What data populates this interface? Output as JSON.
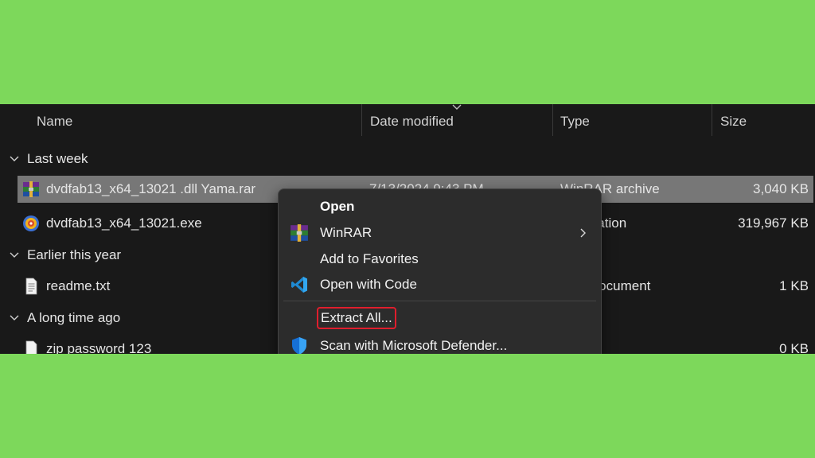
{
  "columns": {
    "name": "Name",
    "date_modified": "Date modified",
    "type": "Type",
    "size": "Size"
  },
  "groups": [
    {
      "label": "Last week"
    },
    {
      "label": "Earlier this year"
    },
    {
      "label": "A long time ago"
    }
  ],
  "files": [
    {
      "name": "dvdfab13_x64_13021 .dll Yama.rar",
      "date": "7/13/2024 9:43 PM",
      "type": "WinRAR archive",
      "size": "3,040 KB",
      "icon": "winrar-icon",
      "selected": true
    },
    {
      "name": "dvdfab13_x64_13021.exe",
      "date": "",
      "type": "Application",
      "size": "319,967 KB",
      "icon": "dvdfab-icon"
    },
    {
      "name": "readme.txt",
      "date": "",
      "type": "Text Document",
      "size": "1 KB",
      "icon": "text-file-icon"
    },
    {
      "name": "zip password 123",
      "date": "",
      "type": "",
      "size": "0 KB",
      "icon": "file-icon"
    }
  ],
  "context_menu": {
    "items": [
      {
        "label": "Open",
        "icon": "",
        "bold": true
      },
      {
        "label": "WinRAR",
        "icon": "winrar-icon",
        "submenu": true
      },
      {
        "label": "Add to Favorites",
        "icon": ""
      },
      {
        "label": "Open with Code",
        "icon": "vscode-icon"
      },
      {
        "label": "Extract All...",
        "icon": "",
        "highlighted": true
      },
      {
        "label": "Scan with Microsoft Defender...",
        "icon": "defender-shield-icon"
      }
    ]
  },
  "colors": {
    "background": "#7dd85b",
    "explorer": "#191919",
    "selected_row": "#777777",
    "menu": "#2c2c2c",
    "highlight": "#e01e2d"
  }
}
